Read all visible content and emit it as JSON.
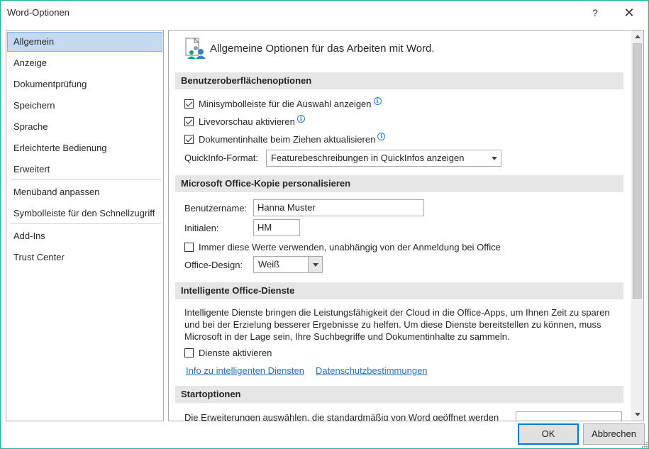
{
  "window": {
    "title": "Word-Optionen",
    "help_glyph": "?",
    "close_glyph": "✕"
  },
  "sidebar": {
    "items": [
      {
        "label": "Allgemein",
        "active": true
      },
      {
        "label": "Anzeige"
      },
      {
        "label": "Dokumentprüfung"
      },
      {
        "label": "Speichern"
      },
      {
        "label": "Sprache"
      },
      {
        "label": "Erleichterte Bedienung"
      },
      {
        "label": "Erweitert"
      },
      {
        "label": "Menüband anpassen"
      },
      {
        "label": "Symbolleiste für den Schnellzugriff"
      },
      {
        "label": "Add-Ins"
      },
      {
        "label": "Trust Center"
      }
    ]
  },
  "header": {
    "icon": "general-options-icon",
    "text": "Allgemeine Optionen für das Arbeiten mit Word."
  },
  "ui_options": {
    "heading": "Benutzeroberflächenoptionen",
    "mini_toolbar": {
      "label": "Minisymbolleiste für die Auswahl anzeigen",
      "checked": true
    },
    "live_preview": {
      "label": "Livevorschau aktivieren",
      "checked": true
    },
    "update_drag": {
      "label": "Dokumentinhalte beim Ziehen aktualisieren",
      "checked": true
    },
    "screentip_label": "QuickInfo-Format:",
    "screentip_value": "Featurebeschreibungen in QuickInfos anzeigen"
  },
  "personalize": {
    "heading": "Microsoft Office-Kopie personalisieren",
    "username_label": "Benutzername:",
    "username_value": "Hanna Muster",
    "initials_label": "Initialen:",
    "initials_value": "HM",
    "always_use": {
      "label": "Immer diese Werte verwenden, unabhängig von der Anmeldung bei Office",
      "checked": false
    },
    "theme_label": "Office-Design:",
    "theme_value": "Weiß"
  },
  "intelligent": {
    "heading": "Intelligente Office-Dienste",
    "description": "Intelligente Dienste bringen die Leistungsfähigkeit der Cloud in die Office-Apps, um Ihnen Zeit zu sparen und bei der Erzielung besserer Ergebnisse zu helfen. Um diese Dienste bereitstellen zu können, muss Microsoft in der Lage sein, Ihre Suchbegriffe und Dokumentinhalte zu sammeln.",
    "enable": {
      "label": "Dienste aktivieren",
      "checked": false
    },
    "link_info": "Info zu intelligenten Diensten",
    "link_privacy": "Datenschutzbestimmungen"
  },
  "startup": {
    "heading": "Startoptionen",
    "text": "Die Erweiterungen auswählen, die standardmäßig von Word geöffnet werden"
  },
  "buttons": {
    "ok": "OK",
    "cancel": "Abbrechen"
  },
  "colors": {
    "accent": "#0078d7",
    "selection": "#c5daf1",
    "link": "#2a6fb5",
    "section_bg": "#e6e6e6"
  }
}
